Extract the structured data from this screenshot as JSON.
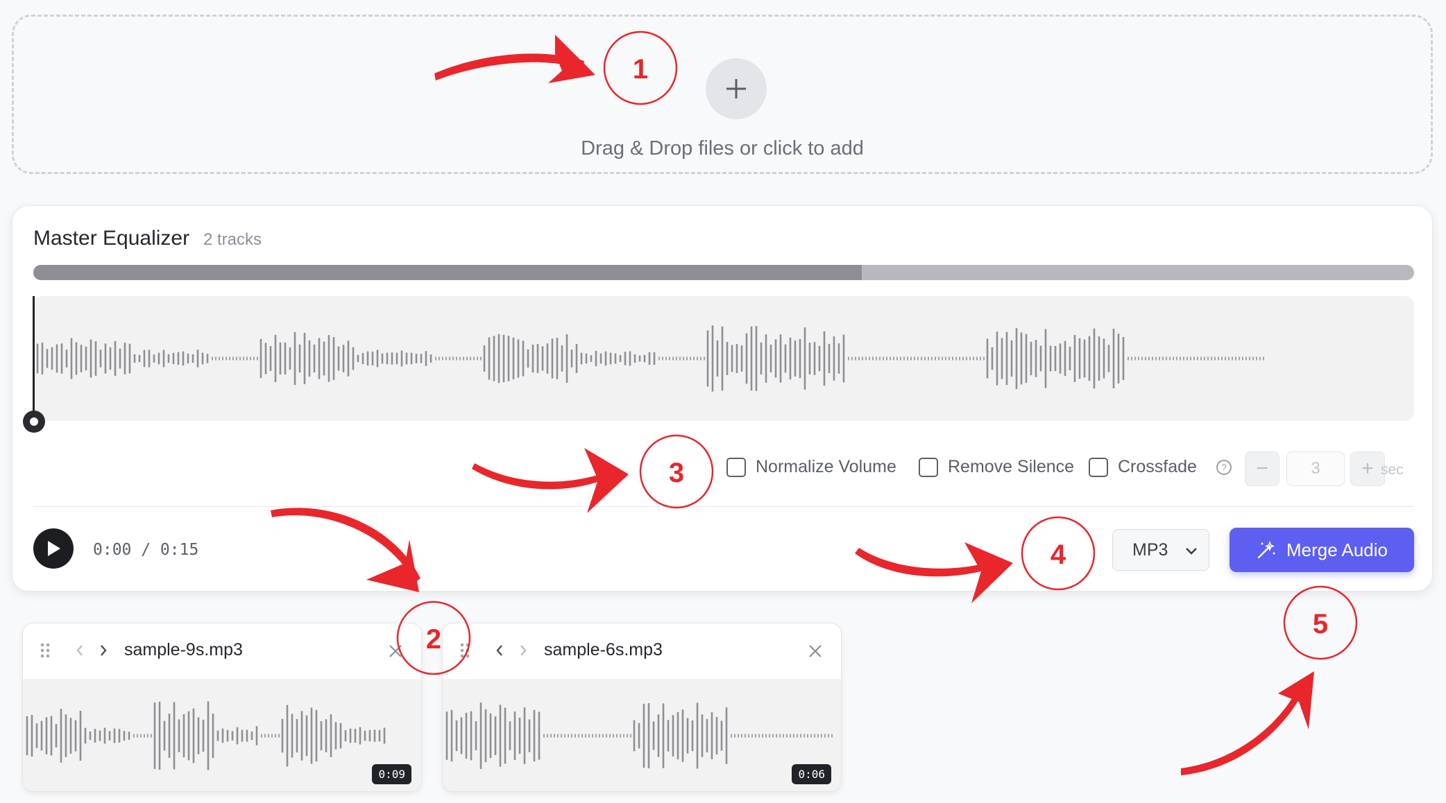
{
  "dropzone": {
    "text": "Drag & Drop files or click to add",
    "add_icon": "plus-icon"
  },
  "master": {
    "title": "Master Equalizer",
    "track_count": "2 tracks",
    "progress": 0.6
  },
  "options": {
    "normalize": {
      "label": "Normalize Volume",
      "checked": false
    },
    "remove_silence": {
      "label": "Remove Silence",
      "checked": false
    },
    "crossfade": {
      "label": "Crossfade",
      "checked": false
    },
    "crossfade_value": "3",
    "crossfade_unit": "sec",
    "minus": "−",
    "plus": "+"
  },
  "player": {
    "time": "0:00 / 0:15"
  },
  "export": {
    "format": "MP3",
    "merge_label": "Merge Audio"
  },
  "tracks": [
    {
      "name": "sample-9s.mp3",
      "duration": "0:09"
    },
    {
      "name": "sample-6s.mp3",
      "duration": "0:06"
    }
  ],
  "annotations": [
    "1",
    "2",
    "3",
    "4",
    "5"
  ],
  "colors": {
    "accent": "#5d5ff0",
    "annotation": "#e8262b",
    "wave": "#8e8f94"
  }
}
